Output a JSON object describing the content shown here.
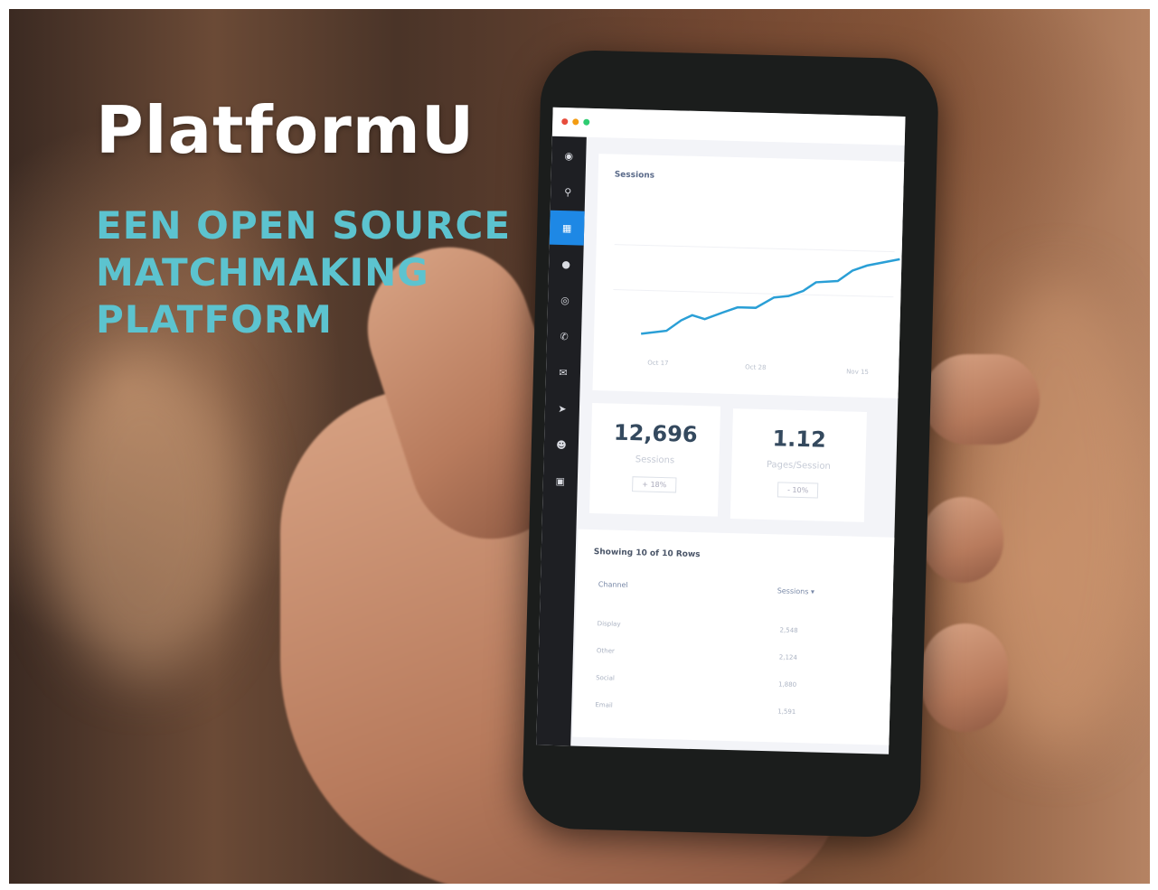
{
  "headline": {
    "title": "PlatformU",
    "subtitle": "EEN OPEN SOURCE MATCHMAKING PLATFORM"
  },
  "phone_screen": {
    "window_dots": [
      "#e74c3c",
      "#f39c12",
      "#2ecc71"
    ],
    "sidebar_icons": [
      "dashboard-icon",
      "search-icon",
      "chart-icon",
      "chat-icon",
      "globe-icon",
      "phone-icon",
      "mail-icon",
      "send-icon",
      "user-icon",
      "calendar-icon"
    ],
    "active_index": 2,
    "chart_card": {
      "title": "Sessions",
      "x_labels": [
        "Oct 17",
        "Oct 28",
        "Nov 15"
      ]
    },
    "stats": [
      {
        "value": "12,696",
        "label": "Sessions",
        "badge": "+ 18%"
      },
      {
        "value": "1.12",
        "label": "Pages/Session",
        "badge": "- 10%"
      }
    ],
    "table": {
      "caption": "Showing 10 of 10 Rows",
      "columns": [
        "Channel",
        "Sessions"
      ],
      "rows": [
        [
          "Display",
          "2,548"
        ],
        [
          "Other",
          "2,124"
        ],
        [
          "Social",
          "1,880"
        ],
        [
          "Email",
          "1,591"
        ]
      ]
    },
    "accent": "#2a9fd6"
  }
}
